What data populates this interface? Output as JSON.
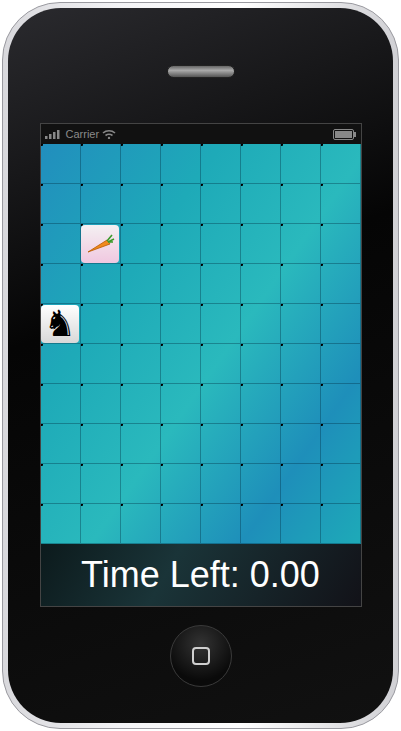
{
  "status_bar": {
    "carrier": "Carrier"
  },
  "board": {
    "rows": 10,
    "columns": 8,
    "pieces": [
      {
        "kind": "carrot",
        "row": 2,
        "column": 1
      },
      {
        "kind": "knight",
        "row": 4,
        "column": 0
      }
    ]
  },
  "timer": {
    "label": "Time Left: 0.00"
  }
}
